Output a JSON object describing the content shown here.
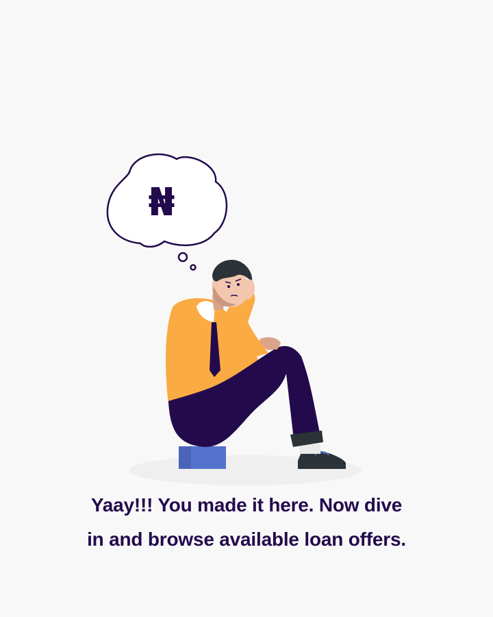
{
  "empty_state": {
    "illustration_icon": "sad-person-thinking-about-money-icon",
    "thought_symbol": "₦",
    "message_line_1": "Yaay!!! You made it here. Now dive",
    "message_line_2": "in and browse available loan offers."
  },
  "colors": {
    "background": "#f8f8f8",
    "text": "#230a4c",
    "shirt": "#fbab43",
    "trousers": "#230a4c",
    "box": "#5473cd"
  }
}
